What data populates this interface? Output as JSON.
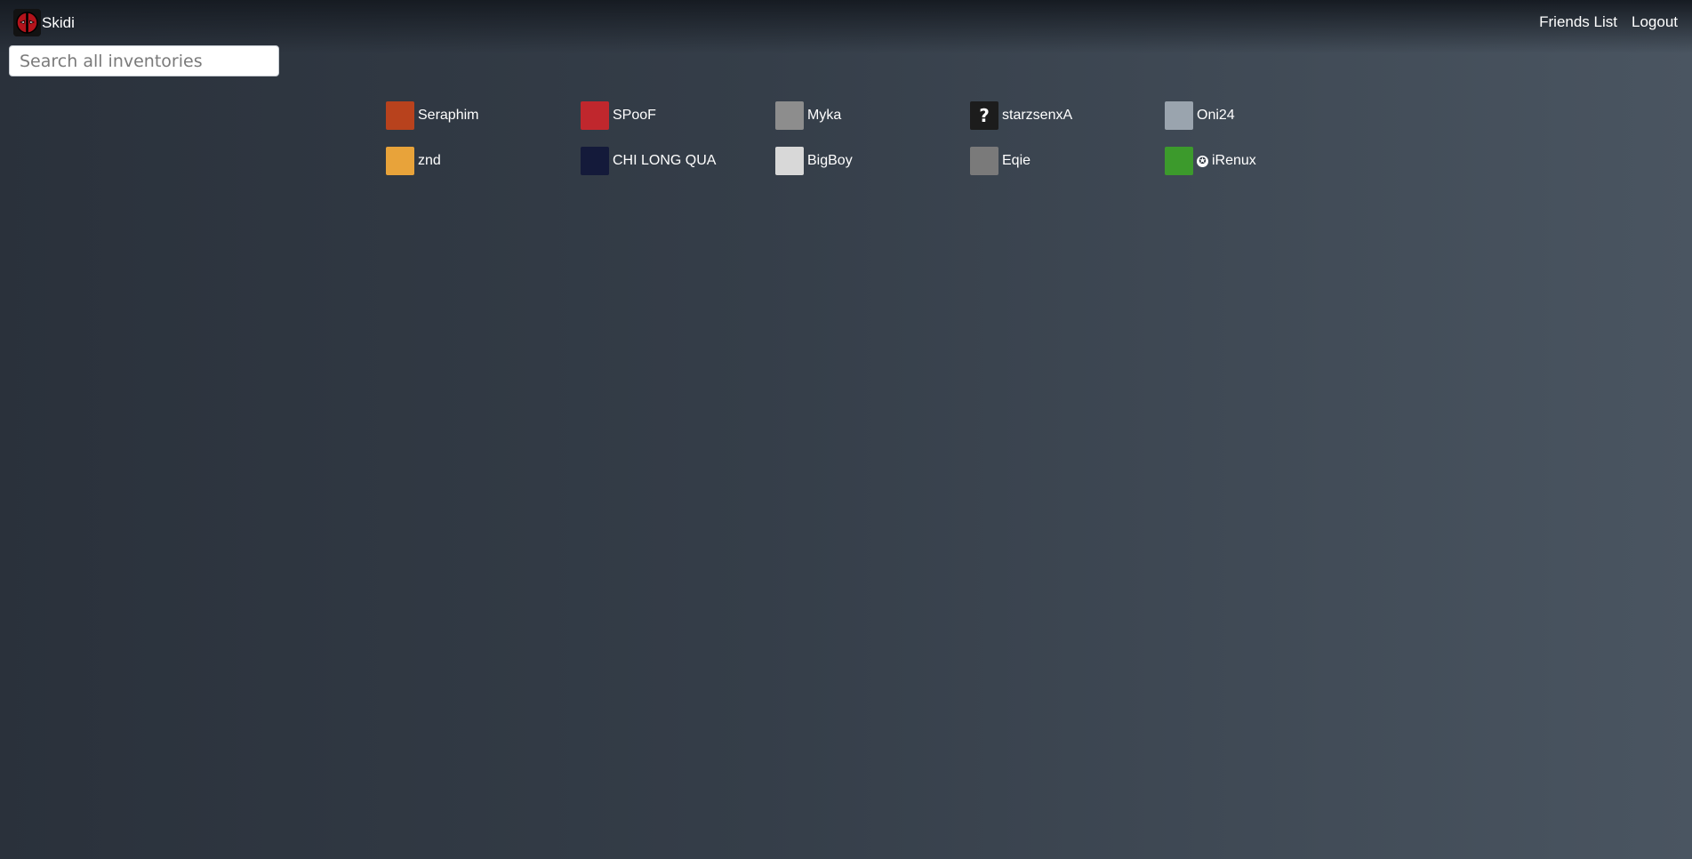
{
  "header": {
    "brand_name": "Skidi",
    "nav": {
      "friends_list": "Friends List",
      "logout": "Logout"
    }
  },
  "search": {
    "placeholder": "Search all inventories",
    "value": ""
  },
  "friends": [
    {
      "name": "Seraphim",
      "avatar_icon": "red-demon-avatar",
      "color": "#b8421d"
    },
    {
      "name": "SPooF",
      "avatar_icon": "red-mask-avatar",
      "color": "#c0272d"
    },
    {
      "name": "Myka",
      "avatar_icon": "gray-sketch-avatar",
      "color": "#8d8d8d"
    },
    {
      "name": "starzsenxA",
      "avatar_icon": "question-mark-avatar",
      "color": "#1c1c1c"
    },
    {
      "name": "Oni24",
      "avatar_icon": "portrait-avatar",
      "color": "#9aa4ae"
    },
    {
      "name": "znd",
      "avatar_icon": "cartoon-glasses-avatar",
      "color": "#e8a33a"
    },
    {
      "name": "CHI LONG QUA",
      "avatar_icon": "yellow-figure-avatar",
      "color": "#141a3a"
    },
    {
      "name": "BigBoy",
      "avatar_icon": "white-sketch-avatar",
      "color": "#d8d8d8"
    },
    {
      "name": "Eqie",
      "avatar_icon": "gray-photo-avatar",
      "color": "#7a7a7a"
    },
    {
      "name": "iRenux",
      "avatar_icon": "green-meme-avatar",
      "color": "#3c9a2c",
      "badge": "✪"
    }
  ]
}
